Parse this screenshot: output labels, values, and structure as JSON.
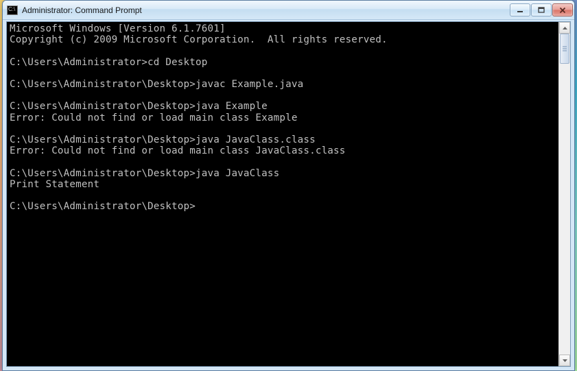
{
  "window": {
    "title": "Administrator: Command Prompt",
    "icon_text": "C:\\"
  },
  "terminal": {
    "lines": [
      "Microsoft Windows [Version 6.1.7601]",
      "Copyright (c) 2009 Microsoft Corporation.  All rights reserved.",
      "",
      "C:\\Users\\Administrator>cd Desktop",
      "",
      "C:\\Users\\Administrator\\Desktop>javac Example.java",
      "",
      "C:\\Users\\Administrator\\Desktop>java Example",
      "Error: Could not find or load main class Example",
      "",
      "C:\\Users\\Administrator\\Desktop>java JavaClass.class",
      "Error: Could not find or load main class JavaClass.class",
      "",
      "C:\\Users\\Administrator\\Desktop>java JavaClass",
      "Print Statement",
      "",
      "C:\\Users\\Administrator\\Desktop>"
    ]
  }
}
